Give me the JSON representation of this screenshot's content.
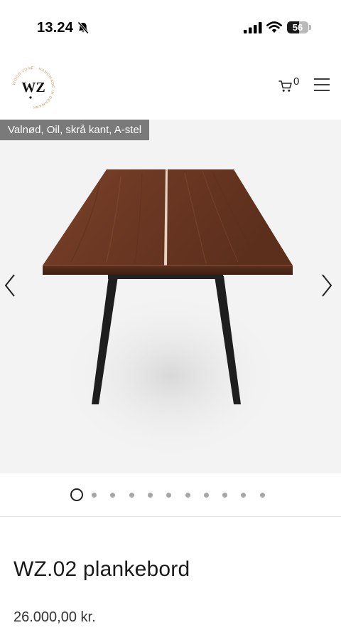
{
  "status_bar": {
    "time": "13.24",
    "battery_level": "56",
    "icons": [
      "bell-slash-icon",
      "signal-icon",
      "wifi-icon",
      "battery-icon"
    ]
  },
  "header": {
    "logo_text": "WZ",
    "logo_ring_text": "WOOD ZONE · HANDMADE IN DENMARK ·",
    "cart_count": "0",
    "icons": [
      "cart-icon",
      "menu-icon"
    ]
  },
  "gallery": {
    "variant_label": "Valnød, Oil, skrå kant, A-stel",
    "slide_count": 11,
    "active_slide": 1,
    "icons": [
      "chevron-left-icon",
      "chevron-right-icon"
    ],
    "colors": {
      "background": "#f3f3f3",
      "badge": "#7a7a7a",
      "wood": "#6b3a24",
      "steel": "#1e1e1e"
    }
  },
  "product": {
    "title": "WZ.02 plankebord",
    "price": "26.000,00 kr."
  }
}
